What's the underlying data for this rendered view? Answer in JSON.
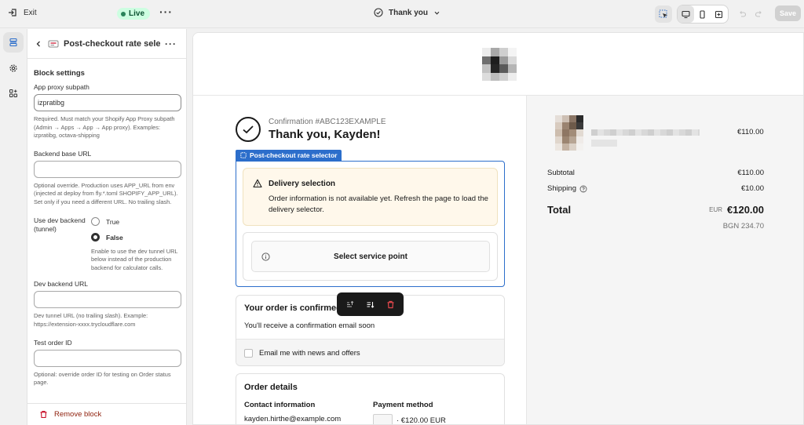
{
  "topbar": {
    "exit_label": "Exit",
    "live_label": "Live",
    "page_title": "Thank you",
    "save_label": "Save"
  },
  "panel": {
    "title": "Post-checkout rate select",
    "section_title": "Block settings",
    "fields": {
      "app_proxy": {
        "label": "App proxy subpath",
        "value": "izpratibg",
        "help": "Required. Must match your Shopify App Proxy subpath (Admin → Apps → App → App proxy). Examples: izpratibg, octava-shipping"
      },
      "backend_url": {
        "label": "Backend base URL",
        "value": "",
        "help": "Optional override. Production uses APP_URL from env (injected at deploy from fly.*.toml SHOPIFY_APP_URL). Set only if you need a different URL. No trailing slash."
      },
      "dev_backend": {
        "label": "Use dev backend (tunnel)",
        "options": [
          "True",
          "False"
        ],
        "selected": "False",
        "help": "Enable to use the dev tunnel URL below instead of the production backend for calculator calls."
      },
      "dev_backend_url": {
        "label": "Dev backend URL",
        "value": "",
        "help": "Dev tunnel URL (no trailing slash). Example: https://extension-xxxx.trycloudflare.com"
      },
      "test_order": {
        "label": "Test order ID",
        "value": "",
        "help": "Optional: override order ID for testing on Order status page."
      }
    },
    "remove_label": "Remove block"
  },
  "preview": {
    "confirmation_number": "Confirmation #ABC123EXAMPLE",
    "thank_you": "Thank you, Kayden!",
    "block_tag": "Post-checkout rate selector",
    "warning_title": "Delivery selection",
    "warning_text": "Order information is not available yet. Refresh the page to load the delivery selector.",
    "service_point_button": "Select service point",
    "order_confirmed_title": "Your order is confirmed",
    "order_confirmed_text": "You'll receive a confirmation email soon",
    "newsletter_label": "Email me with news and offers",
    "order_details_title": "Order details",
    "contact_info_label": "Contact information",
    "contact_email": "kayden.hirthe@example.com",
    "payment_method_label": "Payment method",
    "payment_amount": "· €120.00 EUR"
  },
  "summary": {
    "item_price": "€110.00",
    "subtotal_label": "Subtotal",
    "subtotal_value": "€110.00",
    "shipping_label": "Shipping",
    "shipping_value": "€10.00",
    "total_label": "Total",
    "total_currency": "EUR",
    "total_value": "€120.00",
    "alt_total": "BGN 234.70"
  },
  "colors": {
    "accent": "#2c6ecb",
    "live_bg": "#cdfee1",
    "warning_bg": "#fff8eb",
    "danger": "#c70a24"
  }
}
